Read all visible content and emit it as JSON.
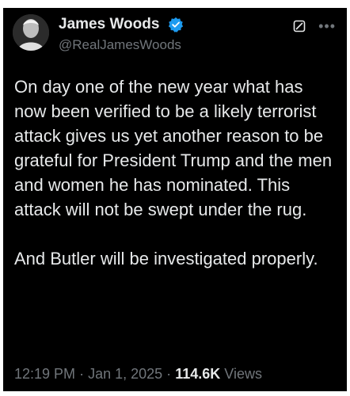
{
  "tweet": {
    "display_name": "James Woods",
    "handle": "@RealJamesWoods",
    "verified": true,
    "body_paragraphs": [
      "On day one of the new year what has now been verified to be a likely terrorist attack gives us yet another reason to be grateful for President Trump and the men and women he has nominated.  This attack will not be swept under the rug.",
      "And Butler will be investigated properly."
    ],
    "time": "12:19 PM",
    "separator": "·",
    "date": "Jan 1, 2025",
    "views_count": "114.6K",
    "views_label": "Views"
  },
  "colors": {
    "background": "#000000",
    "text_primary": "#e7e9ea",
    "text_secondary": "#71767b",
    "verified_badge": "#1d9bf0"
  },
  "icons": {
    "verified": "verified-badge-icon",
    "grok": "grok-icon",
    "more": "more-options-icon"
  }
}
